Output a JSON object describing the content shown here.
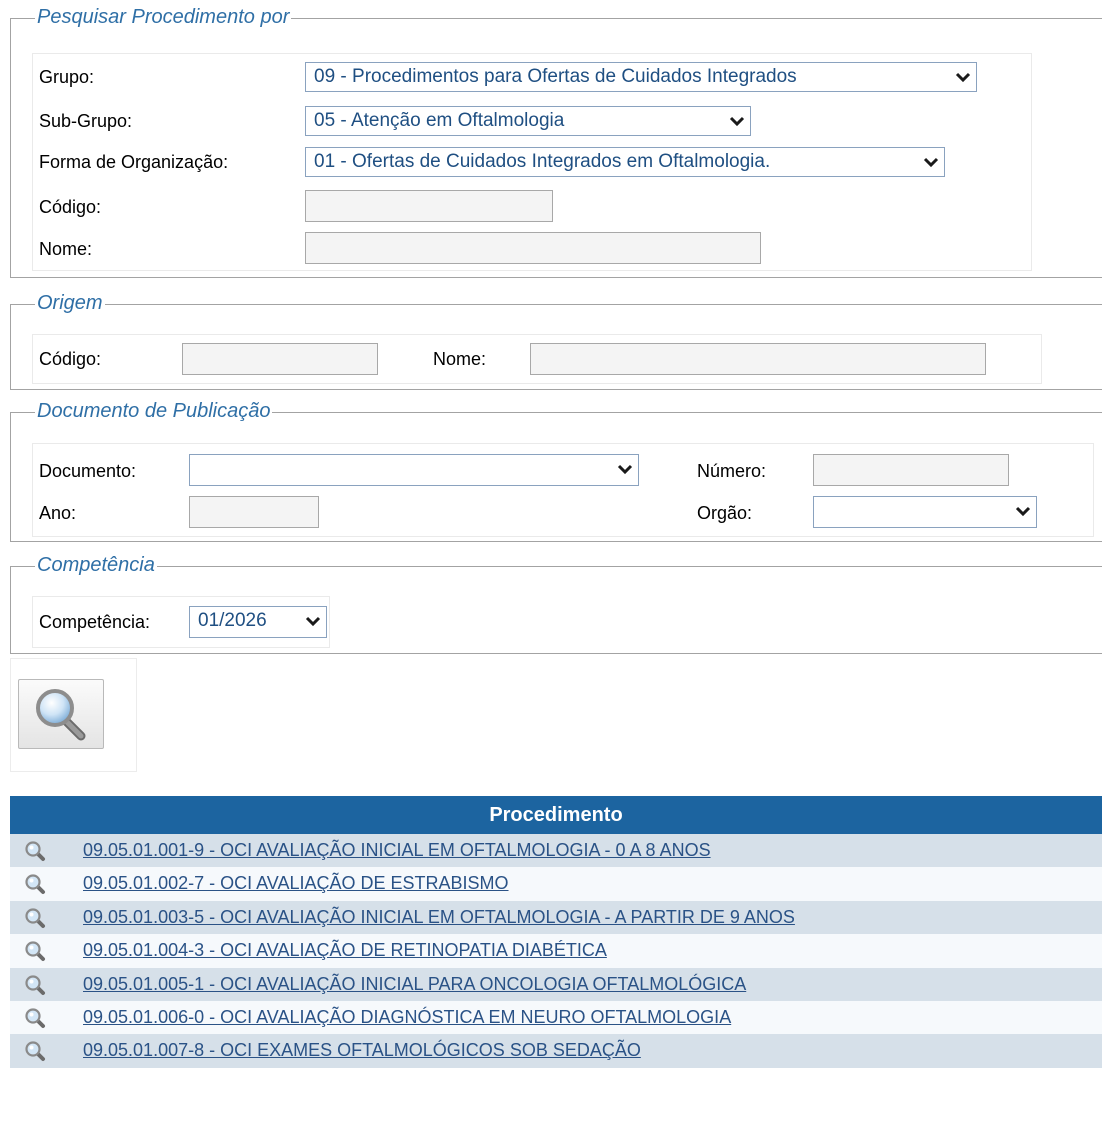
{
  "pesquisar": {
    "legend": "Pesquisar Procedimento por",
    "grupo": {
      "label": "Grupo:",
      "value": "09 - Procedimentos para Ofertas de Cuidados Integrados"
    },
    "subgrupo": {
      "label": "Sub-Grupo:",
      "value": "05 - Atenção em Oftalmologia"
    },
    "forma": {
      "label": "Forma de Organização:",
      "value": "01 - Ofertas de Cuidados Integrados em Oftalmologia."
    },
    "codigo": {
      "label": "Código:",
      "value": ""
    },
    "nome": {
      "label": "Nome:",
      "value": ""
    }
  },
  "origem": {
    "legend": "Origem",
    "codigo": {
      "label": "Código:",
      "value": ""
    },
    "nome": {
      "label": "Nome:",
      "value": ""
    }
  },
  "documento": {
    "legend": "Documento de Publicação",
    "documento": {
      "label": "Documento:",
      "value": ""
    },
    "numero": {
      "label": "Número:",
      "value": ""
    },
    "ano": {
      "label": "Ano:",
      "value": ""
    },
    "orgao": {
      "label": "Orgão:",
      "value": ""
    }
  },
  "competencia": {
    "legend": "Competência",
    "label": "Competência:",
    "value": "01/2026"
  },
  "search_button": {
    "icon": "magnifier-icon"
  },
  "results": {
    "header": "Procedimento",
    "rows": [
      {
        "text": "09.05.01.001-9 - OCI AVALIAÇÃO INICIAL EM OFTALMOLOGIA - 0 A 8 ANOS"
      },
      {
        "text": "09.05.01.002-7 - OCI AVALIAÇÃO DE ESTRABISMO"
      },
      {
        "text": "09.05.01.003-5 - OCI AVALIAÇÃO INICIAL EM OFTALMOLOGIA - A PARTIR DE 9 ANOS"
      },
      {
        "text": "09.05.01.004-3 - OCI AVALIAÇÃO DE RETINOPATIA DIABÉTICA"
      },
      {
        "text": "09.05.01.005-1 - OCI AVALIAÇÃO INICIAL PARA ONCOLOGIA OFTALMOLÓGICA"
      },
      {
        "text": "09.05.01.006-0 - OCI AVALIAÇÃO DIAGNÓSTICA EM NEURO OFTALMOLOGIA"
      },
      {
        "text": "09.05.01.007-8 - OCI EXAMES OFTALMOLÓGICOS SOB SEDAÇÃO"
      }
    ]
  },
  "colors": {
    "legend": "#2f6fa6",
    "select_text": "#1f4f82",
    "table_header": "#1c64a0",
    "row_odd": "#d6e0e9",
    "row_even": "#f6f9fc",
    "link": "#2a5286"
  }
}
